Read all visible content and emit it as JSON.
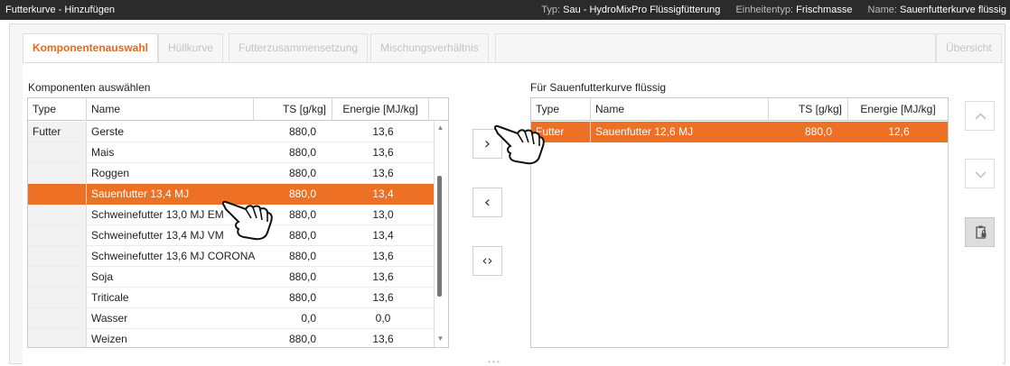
{
  "window": {
    "title": "Futterkurve - Hinzufügen",
    "type_label": "Typ:",
    "type_value": "Sau - HydroMixPro Flüssigfütterung",
    "unit_label": "Einheitentyp:",
    "unit_value": "Frischmasse",
    "name_label": "Name:",
    "name_value": "Sauenfutterkurve flüssig"
  },
  "tabs": [
    {
      "label": "Komponentenauswahl",
      "active": true
    },
    {
      "label": "Hüllkurve",
      "active": false
    },
    {
      "label": "Futterzusammensetzung",
      "active": false
    },
    {
      "label": "Mischungsverhältnis",
      "active": false
    },
    {
      "label": "Übersicht",
      "active": false
    }
  ],
  "left": {
    "heading": "Komponenten auswählen",
    "columns": [
      "Type",
      "Name",
      "TS [g/kg]",
      "Energie [MJ/kg]"
    ],
    "rows": [
      {
        "type": "Futter",
        "name": "Gerste",
        "ts": "880,0",
        "energie": "13,6",
        "selected": false
      },
      {
        "type": "",
        "name": "Mais",
        "ts": "880,0",
        "energie": "13,6",
        "selected": false
      },
      {
        "type": "",
        "name": "Roggen",
        "ts": "880,0",
        "energie": "13,6",
        "selected": false
      },
      {
        "type": "",
        "name": "Sauenfutter 13,4 MJ",
        "ts": "880,0",
        "energie": "13,4",
        "selected": true
      },
      {
        "type": "",
        "name": "Schweinefutter 13,0 MJ EM",
        "ts": "880,0",
        "energie": "13,0",
        "selected": false
      },
      {
        "type": "",
        "name": "Schweinefutter 13,4 MJ VM",
        "ts": "880,0",
        "energie": "13,4",
        "selected": false
      },
      {
        "type": "",
        "name": "Schweinefutter 13,6 MJ CORONA",
        "ts": "880,0",
        "energie": "13,6",
        "selected": false
      },
      {
        "type": "",
        "name": "Soja",
        "ts": "880,0",
        "energie": "13,6",
        "selected": false
      },
      {
        "type": "",
        "name": "Triticale",
        "ts": "880,0",
        "energie": "13,6",
        "selected": false
      },
      {
        "type": "",
        "name": "Wasser",
        "ts": "0,0",
        "energie": "0,0",
        "selected": false
      },
      {
        "type": "",
        "name": "Weizen",
        "ts": "880,0",
        "energie": "13,6",
        "selected": false
      }
    ]
  },
  "transfer": {
    "add_icon": "chevron-right-icon",
    "remove_icon": "chevron-left-icon",
    "swap_icon": "chevron-left-right-icon"
  },
  "right": {
    "heading": "Für Sauenfutterkurve flüssig",
    "columns": [
      "Type",
      "Name",
      "TS [g/kg]",
      "Energie [MJ/kg]"
    ],
    "rows": [
      {
        "type": "Futter",
        "name": "Sauenfutter 12,6 MJ",
        "ts": "880,0",
        "energie": "12,6",
        "selected": true
      }
    ]
  },
  "side_buttons": {
    "up_icon": "chevron-up-icon",
    "down_icon": "chevron-down-icon",
    "clipboard_icon": "clipboard-lock-icon"
  },
  "colors": {
    "accent": "#ee7024",
    "titlebar": "#2b2b2b"
  }
}
